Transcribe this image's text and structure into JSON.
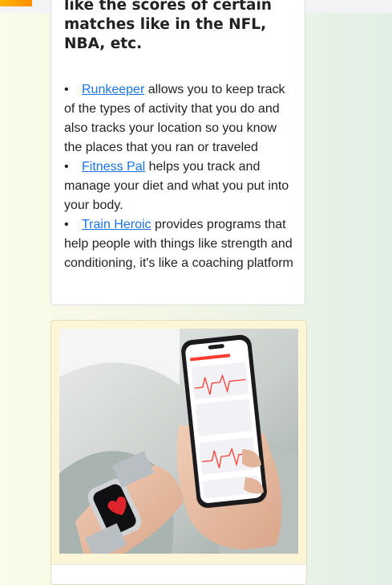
{
  "article": {
    "heading": "like the scores of certain matches like in the NFL, NBA, etc.",
    "items": [
      {
        "link": "Runkeeper",
        "text": " allows you to keep track of the types of activity that you do and also tracks your location so you know the places that you ran or traveled"
      },
      {
        "link": "Fitness Pal",
        "text": " helps you track and manage your diet and what you put into your body."
      },
      {
        "link": "Train Heroic",
        "text": " provides programs that help people with things like strength and conditioning, it's like a coaching platform"
      }
    ],
    "bullet": "•"
  },
  "image_card": {
    "photo_icon": "smartwatch-phone-photo"
  }
}
